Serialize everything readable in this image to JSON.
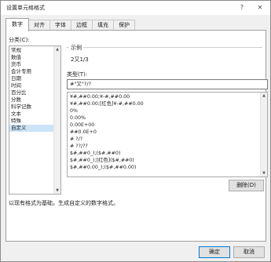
{
  "window": {
    "title": "设置单元格格式",
    "help_label": "?",
    "close_label": "✕"
  },
  "tabs": [
    {
      "label": "数字",
      "active": true
    },
    {
      "label": "对齐"
    },
    {
      "label": "字体"
    },
    {
      "label": "边框"
    },
    {
      "label": "填充"
    },
    {
      "label": "保护"
    }
  ],
  "category": {
    "label": "分类(C):",
    "items": [
      "常规",
      "数值",
      "货币",
      "会计专用",
      "日期",
      "时间",
      "百分比",
      "分数",
      "科学记数",
      "文本",
      "特殊",
      "自定义"
    ],
    "selected": "自定义"
  },
  "sample": {
    "label": "示例",
    "value": "2又1/3"
  },
  "type": {
    "label": "类型(T):",
    "value": "#\"又\"?/?"
  },
  "formats": [
    "¥#,##0.00;¥-#,##0.00",
    "¥#,##0.00;[红色]¥-#,##0.00",
    "0%",
    "0.00%",
    "0.00E+00",
    "##0.0E+0",
    "# ?/?",
    "# ??/??",
    "$#,##0_);($#,##0)",
    "$#,##0_);[红色]($#,##0)",
    "$#,##0.00_);($#,##0.00)"
  ],
  "buttons": {
    "delete": "删除(D)",
    "ok": "确定",
    "cancel": "取消"
  },
  "description": "以现有格式为基础，生成自定义的数字格式。",
  "colors": {
    "accent": "#0078d7",
    "selection": "#cce4f7"
  }
}
